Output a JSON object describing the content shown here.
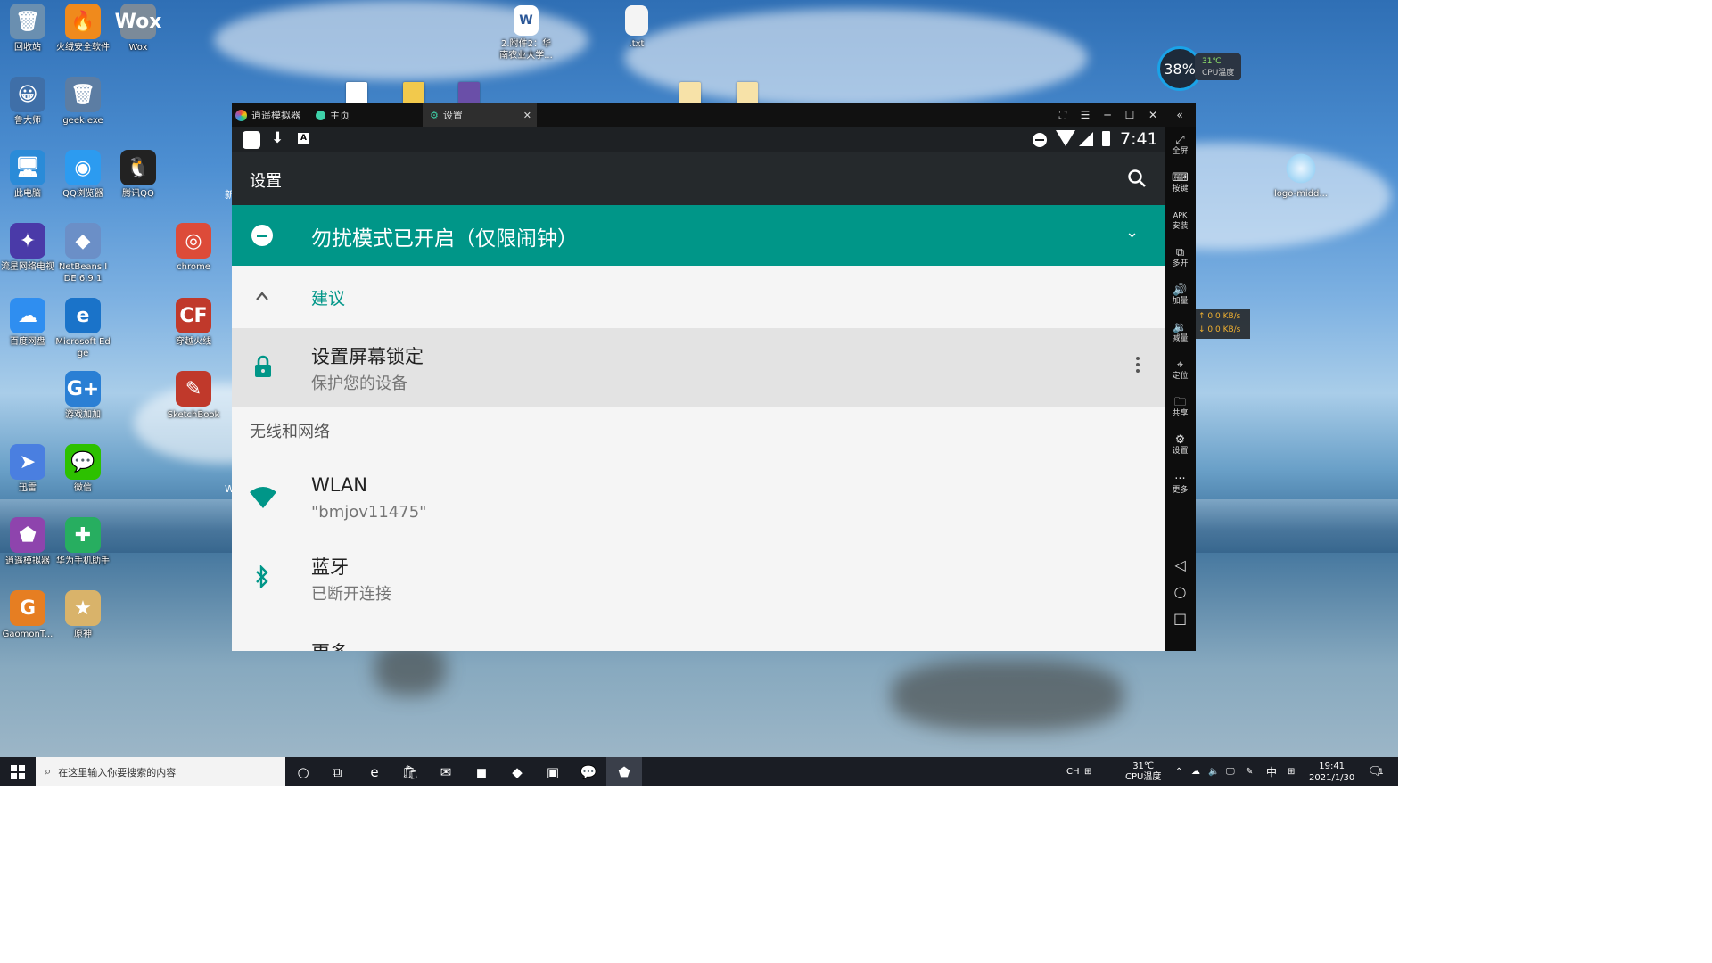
{
  "desktop": {
    "icons": [
      {
        "label": "回收站",
        "glyph": "🗑",
        "color": "#6a8fb0"
      },
      {
        "label": "火绒安全软件",
        "glyph": "🔥",
        "color": "#f08a1c"
      },
      {
        "label": "Wox",
        "glyph": "Wox",
        "color": "#7b8a99"
      },
      {
        "label": "鲁大师",
        "glyph": "😀",
        "color": "#3f6fa8"
      },
      {
        "label": "geek.exe",
        "glyph": "🗑",
        "color": "#5c7da3"
      },
      {
        "label": "此电脑",
        "glyph": "🖥",
        "color": "#2a8bd8"
      },
      {
        "label": "QQ浏览器",
        "glyph": "◉",
        "color": "#2c9bf0"
      },
      {
        "label": "腾讯QQ",
        "glyph": "🐧",
        "color": "#222"
      },
      {
        "label": "流星网络电视",
        "glyph": "✦",
        "color": "#4a3aa8"
      },
      {
        "label": "NetBeans IDE 6.9.1",
        "glyph": "◆",
        "color": "#6b8fc7"
      },
      {
        "label": "chrome",
        "glyph": "◎",
        "color": "#dd4b39"
      },
      {
        "label": "百度网盘",
        "glyph": "☁",
        "color": "#2f8ef0"
      },
      {
        "label": "Microsoft Edge",
        "glyph": "e",
        "color": "#1a73c9"
      },
      {
        "label": "穿越火线",
        "glyph": "CF",
        "color": "#c0392b"
      },
      {
        "label": "游戏加加",
        "glyph": "G+",
        "color": "#2a7fd4"
      },
      {
        "label": "SketchBook",
        "glyph": "✎",
        "color": "#c0392b"
      },
      {
        "label": "迅雷",
        "glyph": "➤",
        "color": "#4a7fe0"
      },
      {
        "label": "微信",
        "glyph": "💬",
        "color": "#2dc100"
      },
      {
        "label": "逍遥模拟器",
        "glyph": "⬟",
        "color": "#8e44ad"
      },
      {
        "label": "华为手机助手",
        "glyph": "✚",
        "color": "#27ae60"
      },
      {
        "label": "GaomonT...",
        "glyph": "G",
        "color": "#e67e22"
      },
      {
        "label": "原神",
        "glyph": "★",
        "color": "#d9b36a"
      }
    ],
    "top_files": [
      {
        "label": "2.附件2：华南农业大学..."
      },
      {
        "label": ".txt"
      }
    ],
    "right_icon_label": "logo-midd...",
    "edge_labels": [
      "新",
      "W"
    ]
  },
  "cpu_widget": {
    "percent": "38%",
    "temp": "31℃",
    "caption": "CPU温度"
  },
  "net_speed": {
    "up": "↑ 0.0 KB/s",
    "down": "↓ 0.0 KB/s"
  },
  "emulator": {
    "tabs": [
      {
        "label": "逍遥模拟器"
      },
      {
        "label": "主页"
      },
      {
        "label": "设置",
        "close": "✕"
      }
    ],
    "window_controls": [
      "⛶",
      "☰",
      "─",
      "☐",
      "✕",
      "«"
    ],
    "status_bar": {
      "time": "7:41"
    },
    "settings": {
      "title": "设置",
      "dnd_banner": "勿扰模式已开启（仅限闹钟）",
      "suggestion_header": "建议",
      "suggestion": {
        "title": "设置屏幕锁定",
        "subtitle": "保护您的设备"
      },
      "section_header": "无线和网络",
      "items": [
        {
          "title": "WLAN",
          "subtitle": "\"bmjov11475\""
        },
        {
          "title": "蓝牙",
          "subtitle": "已断开连接"
        }
      ],
      "cut_item": "更多"
    },
    "sidebar": [
      {
        "label": "全屏",
        "sym": "⤢"
      },
      {
        "label": "按键",
        "sym": "⌨"
      },
      {
        "label": "安装",
        "sym": "APK"
      },
      {
        "label": "多开",
        "sym": "⧉"
      },
      {
        "label": "加量",
        "sym": "🔊"
      },
      {
        "label": "减量",
        "sym": "🔉"
      },
      {
        "label": "定位",
        "sym": "⌖"
      },
      {
        "label": "共享",
        "sym": "🗀"
      },
      {
        "label": "设置",
        "sym": "⚙"
      },
      {
        "label": "更多",
        "sym": "···"
      }
    ],
    "nav_buttons": [
      "◁",
      "○",
      "□"
    ]
  },
  "taskbar": {
    "search_placeholder": "在这里输入你要搜索的内容",
    "apps": [
      "○",
      "⧉",
      "e",
      "🛍",
      "✉",
      "◼",
      "◆",
      "▣",
      "💬",
      "⬟"
    ],
    "tray": {
      "ime_short": "CH",
      "temp": "31℃",
      "temp_caption": "CPU温度",
      "ime": "中",
      "time": "19:41",
      "date": "2021/1/30",
      "notif": "1"
    }
  }
}
